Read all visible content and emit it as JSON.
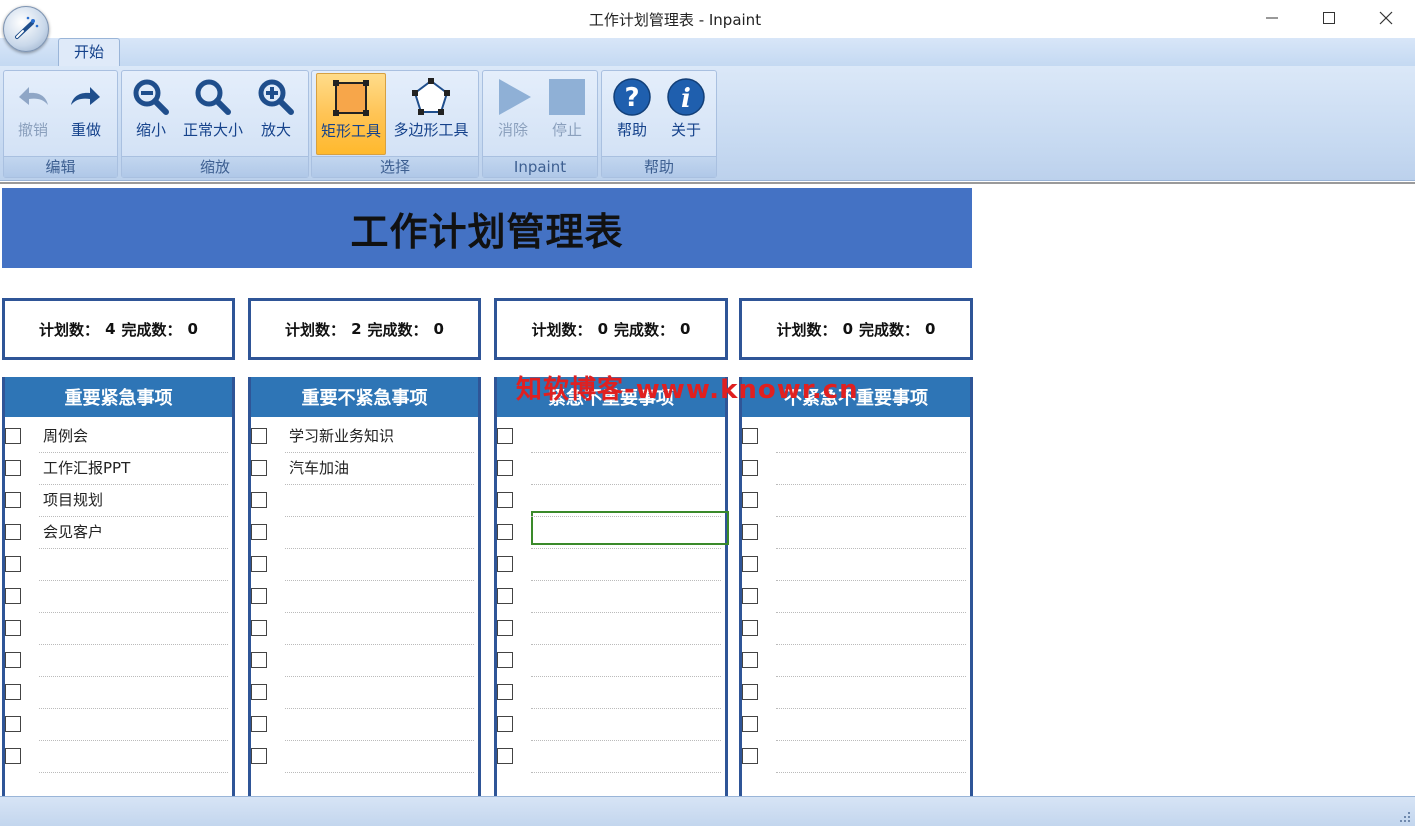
{
  "window": {
    "title": "工作计划管理表 - Inpaint",
    "controls": [
      "minimize-icon",
      "maximize-icon",
      "close-icon"
    ]
  },
  "tabs": [
    {
      "label": "开始"
    }
  ],
  "ribbon": {
    "groups": [
      {
        "label": "编辑",
        "buttons": [
          {
            "label": "撤销",
            "icon": "undo-icon",
            "enabled": false
          },
          {
            "label": "重做",
            "icon": "redo-icon",
            "enabled": true
          }
        ]
      },
      {
        "label": "缩放",
        "buttons": [
          {
            "label": "缩小",
            "icon": "zoom-out-icon"
          },
          {
            "label": "正常大小",
            "icon": "zoom-normal-icon"
          },
          {
            "label": "放大",
            "icon": "zoom-in-icon"
          }
        ]
      },
      {
        "label": "选择",
        "buttons": [
          {
            "label": "矩形工具",
            "icon": "rectangle-tool-icon",
            "active": true
          },
          {
            "label": "多边形工具",
            "icon": "polygon-tool-icon"
          }
        ]
      },
      {
        "label": "Inpaint",
        "buttons": [
          {
            "label": "消除",
            "icon": "play-icon",
            "enabled": false
          },
          {
            "label": "停止",
            "icon": "stop-icon",
            "enabled": false
          }
        ]
      },
      {
        "label": "帮助",
        "buttons": [
          {
            "label": "帮助",
            "icon": "help-icon"
          },
          {
            "label": "关于",
            "icon": "info-icon"
          }
        ]
      }
    ]
  },
  "sheet": {
    "title": "工作计划管理表",
    "stats": [
      {
        "plan_label": "计划数：",
        "plan": "4",
        "done_label": "完成数：",
        "done": "0"
      },
      {
        "plan_label": "计划数：",
        "plan": "2",
        "done_label": "完成数：",
        "done": "0"
      },
      {
        "plan_label": "计划数：",
        "plan": "0",
        "done_label": "完成数：",
        "done": "0"
      },
      {
        "plan_label": "计划数：",
        "plan": "0",
        "done_label": "完成数：",
        "done": "0"
      }
    ],
    "columns": [
      {
        "header": "重要紧急事项",
        "items": [
          "周例会",
          "工作汇报PPT",
          "项目规划",
          "会见客户",
          "",
          "",
          "",
          "",
          "",
          "",
          ""
        ]
      },
      {
        "header": "重要不紧急事项",
        "items": [
          "学习新业务知识",
          "汽车加油",
          "",
          "",
          "",
          "",
          "",
          "",
          "",
          "",
          ""
        ]
      },
      {
        "header": "紧急不重要事项",
        "items": [
          "",
          "",
          "",
          "",
          "",
          "",
          "",
          "",
          "",
          "",
          ""
        ]
      },
      {
        "header": "不紧急不重要事项",
        "items": [
          "",
          "",
          "",
          "",
          "",
          "",
          "",
          "",
          "",
          "",
          ""
        ]
      }
    ]
  },
  "watermark": "知软博客-www.knowr.cn",
  "colors": {
    "banner": "#4472c4",
    "header": "#2e75b6",
    "border": "#2f5597",
    "ribbon": "#c6d9f1",
    "active_tool": "#ffc456"
  }
}
